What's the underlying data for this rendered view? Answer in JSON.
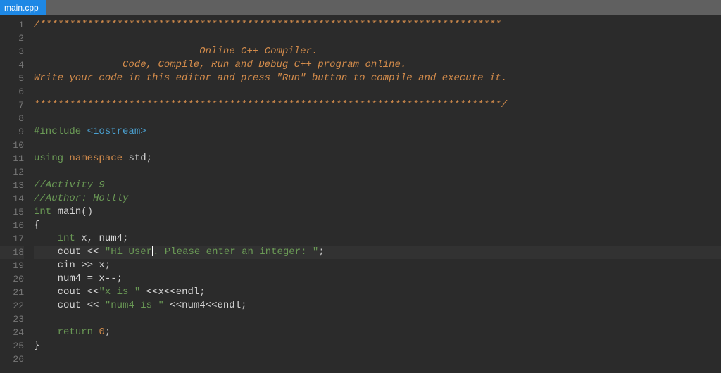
{
  "tab": {
    "label": "main.cpp"
  },
  "gutter": {
    "lines": [
      "1",
      "2",
      "3",
      "4",
      "5",
      "6",
      "7",
      "8",
      "9",
      "10",
      "11",
      "12",
      "13",
      "14",
      "15",
      "16",
      "17",
      "18",
      "19",
      "20",
      "21",
      "22",
      "23",
      "24",
      "25",
      "26"
    ]
  },
  "code": {
    "l1": "/******************************************************************************",
    "l3a": "                            ",
    "l3b": "Online C++ Compiler.",
    "l4a": "               ",
    "l4b": "Code, Compile, Run and Debug C++ program online.",
    "l5": "Write your code in this editor and press \"Run\" button to compile and execute it.",
    "l7": "*******************************************************************************/",
    "l9a": "#include ",
    "l9b": "<iostream>",
    "l11a": "using",
    "l11b": " namespace ",
    "l11c": "std",
    "l11d": ";",
    "l13": "//Activity 9",
    "l14": "//Author: Hollly",
    "l15a": "int",
    "l15b": " main",
    "l15c": "()",
    "l16": "{",
    "l17a": "    ",
    "l17b": "int",
    "l17c": " x",
    "l17d": ",",
    "l17e": " num4",
    "l17f": ";",
    "l18a": "    cout ",
    "l18b": "<<",
    "l18c": " ",
    "l18d": "\"Hi User",
    "l18e": ". Please enter an integer: \"",
    "l18f": ";",
    "l19a": "    cin ",
    "l19b": ">>",
    "l19c": " x",
    "l19d": ";",
    "l20a": "    num4 ",
    "l20b": "=",
    "l20c": " x",
    "l20d": "--",
    "l20e": ";",
    "l21a": "    cout ",
    "l21b": "<<",
    "l21c": "\"x is \"",
    "l21d": " ",
    "l21e": "<<",
    "l21f": "x",
    "l21g": "<<",
    "l21h": "endl",
    "l21i": ";",
    "l22a": "    cout ",
    "l22b": "<<",
    "l22c": " ",
    "l22d": "\"num4 is \"",
    "l22e": " ",
    "l22f": "<<",
    "l22g": "num4",
    "l22h": "<<",
    "l22i": "endl",
    "l22j": ";",
    "l24a": "    ",
    "l24b": "return",
    "l24c": " ",
    "l24d": "0",
    "l24e": ";",
    "l25": "}"
  }
}
